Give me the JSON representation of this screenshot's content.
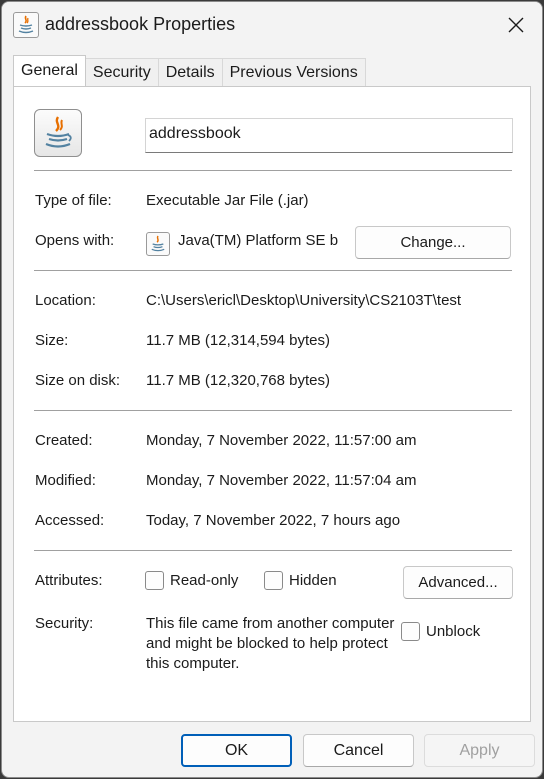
{
  "window": {
    "title": "addressbook Properties",
    "icon": "java-icon"
  },
  "tabs": [
    {
      "label": "General",
      "active": true
    },
    {
      "label": "Security",
      "active": false
    },
    {
      "label": "Details",
      "active": false
    },
    {
      "label": "Previous Versions",
      "active": false
    }
  ],
  "general": {
    "file_name": "addressbook",
    "type_label": "Type of file:",
    "type_value": "Executable Jar File (.jar)",
    "opens_label": "Opens with:",
    "opens_value": "Java(TM) Platform SE b",
    "change_button": "Change...",
    "location_label": "Location:",
    "location_value": "C:\\Users\\ericl\\Desktop\\University\\CS2103T\\test",
    "size_label": "Size:",
    "size_value": "11.7 MB (12,314,594 bytes)",
    "size_disk_label": "Size on disk:",
    "size_disk_value": "11.7 MB (12,320,768 bytes)",
    "created_label": "Created:",
    "created_value": "Monday, 7 November 2022, 11:57:00 am",
    "modified_label": "Modified:",
    "modified_value": "Monday, 7 November 2022, 11:57:04 am",
    "accessed_label": "Accessed:",
    "accessed_value": "Today, 7 November 2022, 7 hours ago",
    "attributes_label": "Attributes:",
    "readonly_label": "Read-only",
    "readonly_checked": false,
    "hidden_label": "Hidden",
    "hidden_checked": false,
    "advanced_button": "Advanced...",
    "security_label": "Security:",
    "security_text": "This file came from another computer and might be blocked to help protect this computer.",
    "unblock_label": "Unblock",
    "unblock_checked": false
  },
  "footer": {
    "ok": "OK",
    "cancel": "Cancel",
    "apply": "Apply"
  },
  "colors": {
    "ok_border": "#005fb8",
    "disabled_text": "#a0a0a0",
    "java_red": "#e76f00",
    "java_blue": "#5382a1"
  }
}
